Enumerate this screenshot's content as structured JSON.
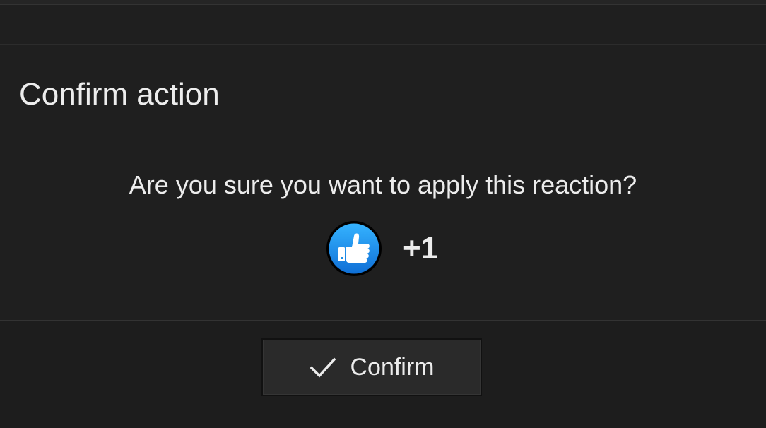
{
  "dialog": {
    "title": "Confirm action",
    "message": "Are you sure you want to apply this reaction?"
  },
  "reaction": {
    "icon": "thumbs-up-icon",
    "label": "+1",
    "color": "#1a8ee6"
  },
  "actions": {
    "confirm_label": "Confirm",
    "confirm_icon": "check-icon"
  },
  "colors": {
    "background": "#1f1f1f",
    "button": "#2a2a2a",
    "text": "#ececec"
  }
}
